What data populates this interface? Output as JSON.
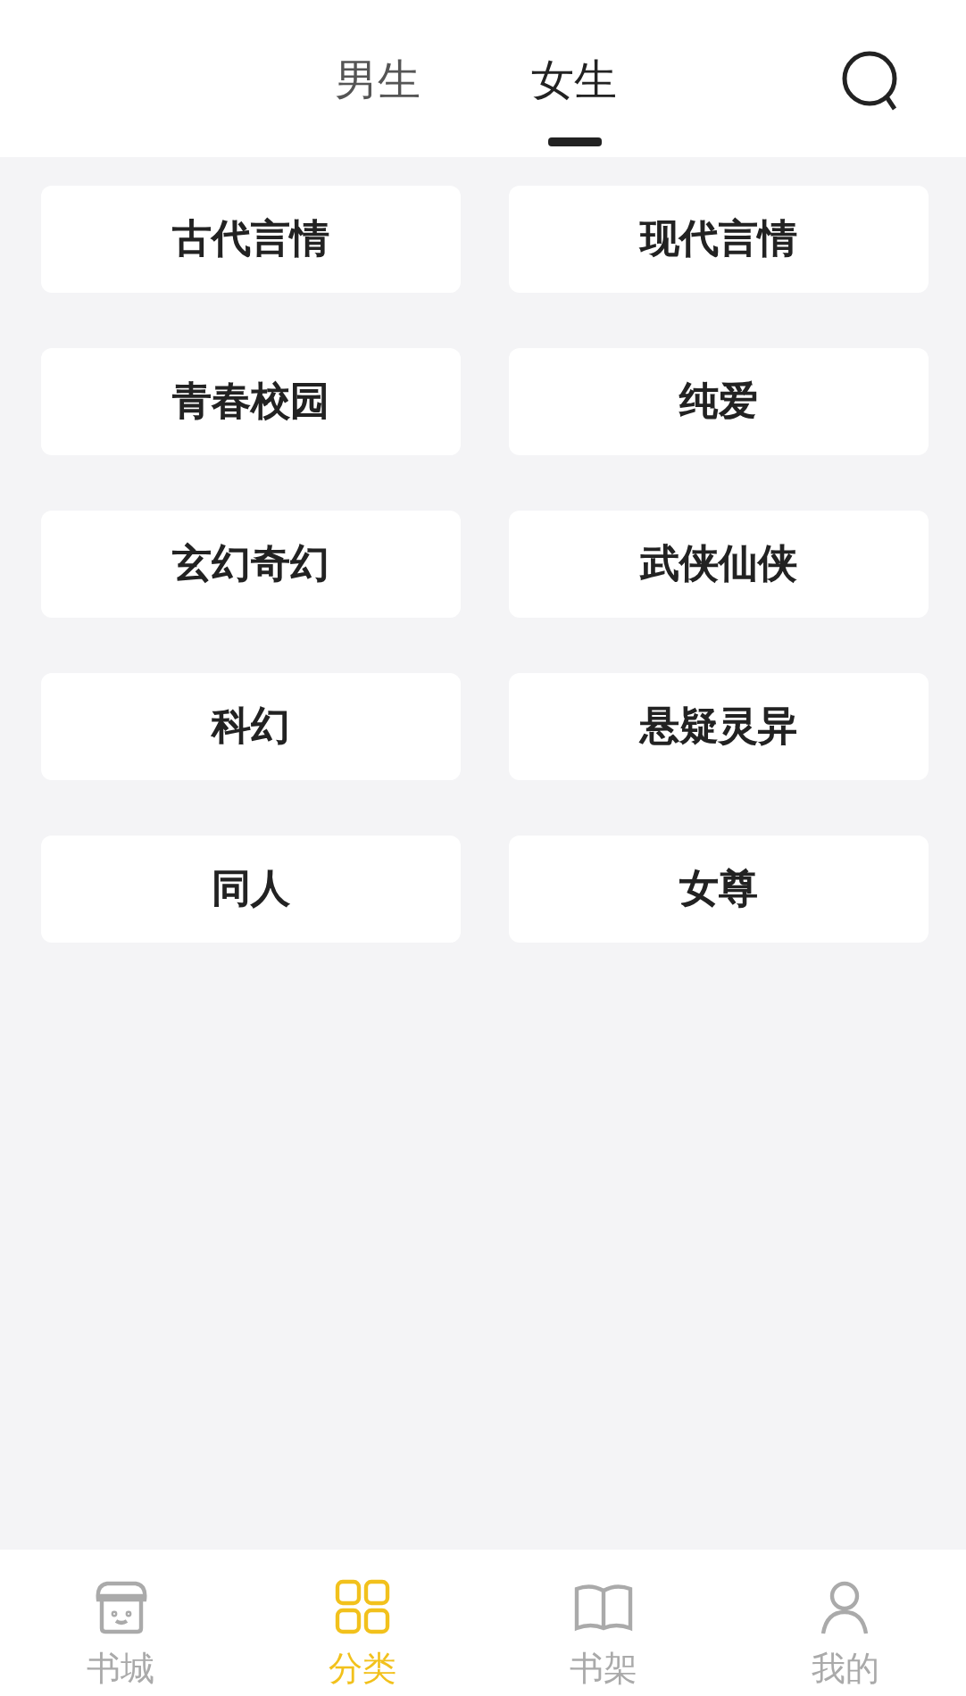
{
  "tabs": [
    {
      "label": "男生",
      "selected": false
    },
    {
      "label": "女生",
      "selected": true
    }
  ],
  "categories": [
    "古代言情",
    "现代言情",
    "青春校园",
    "纯爱",
    "玄幻奇幻",
    "武侠仙侠",
    "科幻",
    "悬疑灵异",
    "同人",
    "女尊"
  ],
  "bottom_nav": [
    {
      "label": "书城",
      "kind": "store",
      "selected": false
    },
    {
      "label": "分类",
      "kind": "grid",
      "selected": true
    },
    {
      "label": "书架",
      "kind": "book",
      "selected": false
    },
    {
      "label": "我的",
      "kind": "person",
      "selected": false
    }
  ]
}
